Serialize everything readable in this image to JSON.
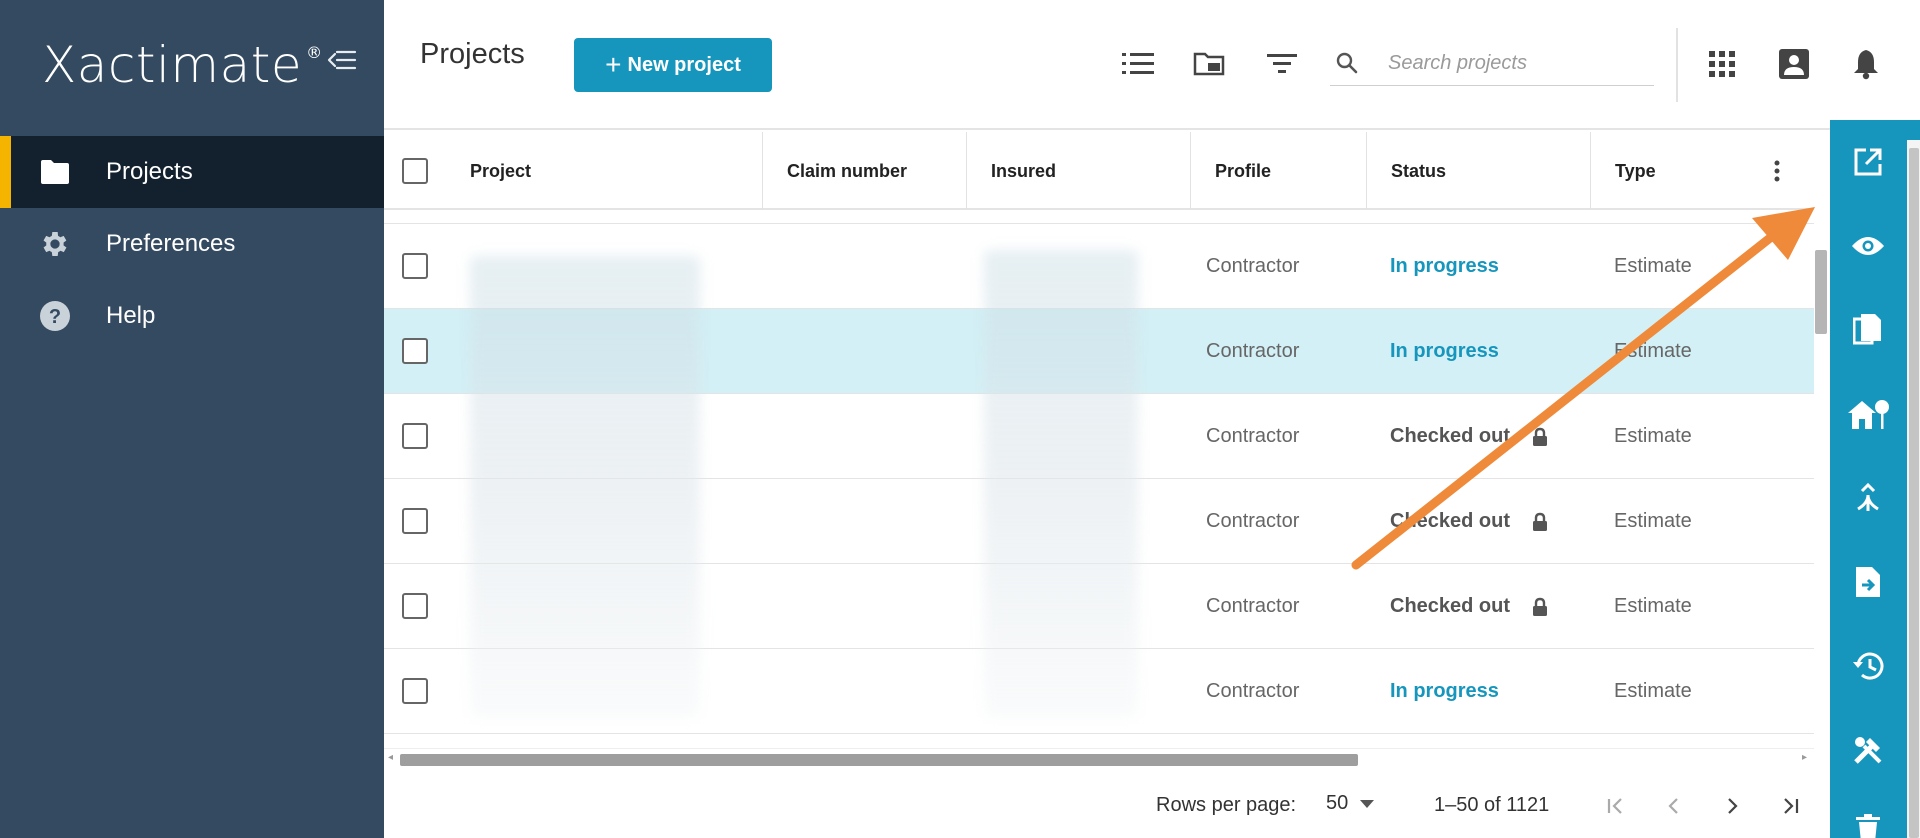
{
  "app": {
    "brand": "Xactimate",
    "brand_mark": "®"
  },
  "sidebar": {
    "items": [
      {
        "label": "Projects",
        "icon": "folder-icon",
        "active": true
      },
      {
        "label": "Preferences",
        "icon": "gear-icon",
        "active": false
      },
      {
        "label": "Help",
        "icon": "help-icon",
        "active": false
      }
    ]
  },
  "header": {
    "title": "Projects",
    "new_button": "New project",
    "search_placeholder": "Search projects"
  },
  "table": {
    "columns": [
      "Project",
      "Claim number",
      "Insured",
      "Profile",
      "Status",
      "Type"
    ],
    "rows": [
      {
        "profile": "Contractor",
        "status": "In progress",
        "type": "Estimate",
        "locked": false,
        "selected": false
      },
      {
        "profile": "Contractor",
        "status": "In progress",
        "type": "Estimate",
        "locked": false,
        "selected": true
      },
      {
        "profile": "Contractor",
        "status": "Checked out",
        "type": "Estimate",
        "locked": true,
        "selected": false
      },
      {
        "profile": "Contractor",
        "status": "Checked out",
        "type": "Estimate",
        "locked": true,
        "selected": false
      },
      {
        "profile": "Contractor",
        "status": "Checked out",
        "type": "Estimate",
        "locked": true,
        "selected": false
      },
      {
        "profile": "Contractor",
        "status": "In progress",
        "type": "Estimate",
        "locked": false,
        "selected": false
      }
    ]
  },
  "pagination": {
    "rows_per_page_label": "Rows per page:",
    "rows_per_page": "50",
    "range": "1–50 of 1121"
  },
  "colors": {
    "accent": "#1796bd",
    "sidebar": "#344a60",
    "active_nav": "#13202d",
    "active_marker": "#f5b400",
    "annotation_arrow": "#ee8a3a"
  }
}
